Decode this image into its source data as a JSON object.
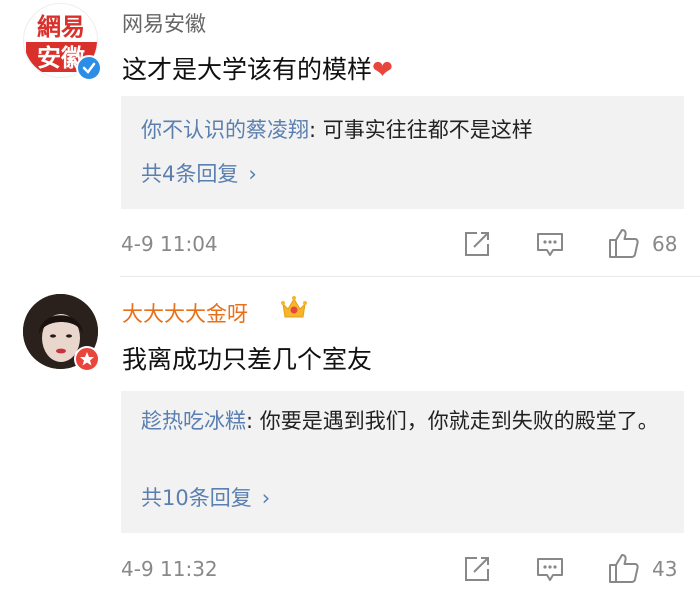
{
  "comments": [
    {
      "user": "网易安徽",
      "avatar_text": [
        "網易",
        "安徽"
      ],
      "text": "这才是大学该有的模样",
      "heart": "❤",
      "reply": {
        "user": "你不认识的蔡凌翔",
        "text": ": 可事实往往都不是这样",
        "count_label": "共4条回复",
        "chevron": "›"
      },
      "time": "4-9 11:04",
      "likes": "68"
    },
    {
      "user": "大大大大金呀",
      "text": "我离成功只差几个室友",
      "reply": {
        "user": "趁热吃冰糕",
        "text": ": 你要是遇到我们，你就走到失败的殿堂了。",
        "count_label": "共10条回复",
        "chevron": "›"
      },
      "time": "4-9 11:32",
      "likes": "43"
    }
  ],
  "colors": {
    "username_blue": "#5a7fb0",
    "vip_orange": "#e8701a",
    "gray_text": "#888888",
    "reply_bg": "#f2f2f2",
    "verified_blue": "#2c8de6",
    "badge_red": "#e8453c"
  },
  "icons": [
    "verified-badge-icon",
    "crown-icon",
    "share-icon",
    "comment-icon",
    "like-icon"
  ]
}
